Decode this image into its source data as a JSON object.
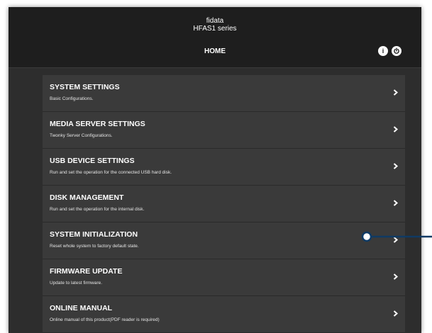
{
  "header": {
    "brand_line1": "fidata",
    "brand_line2": "HFAS1 series",
    "page_title": "HOME"
  },
  "menu": {
    "items": [
      {
        "title": "SYSTEM SETTINGS",
        "description": "Basic Configurations."
      },
      {
        "title": "MEDIA SERVER SETTINGS",
        "description": "Twonky Server Configurations."
      },
      {
        "title": "USB DEVICE SETTINGS",
        "description": "Run and set the operation for the connected USB hard disk."
      },
      {
        "title": "DISK MANAGEMENT",
        "description": "Run and set the operation for the internal disk."
      },
      {
        "title": "SYSTEM INITIALIZATION",
        "description": "Reset whole system to factory default state."
      },
      {
        "title": "FIRMWARE UPDATE",
        "description": "Update to latest firmware."
      },
      {
        "title": "ONLINE MANUAL",
        "description": "Online manual of this product(PDF reader is required)"
      }
    ]
  },
  "colors": {
    "header_bg": "#1e1e1e",
    "panel_bg": "#2d2d2d",
    "item_bg": "#3a3a3a",
    "text": "#ffffff",
    "callout": "#0f3a64"
  },
  "icons": {
    "info": "info-icon",
    "power": "power-icon",
    "chevron": "chevron-right-icon"
  }
}
